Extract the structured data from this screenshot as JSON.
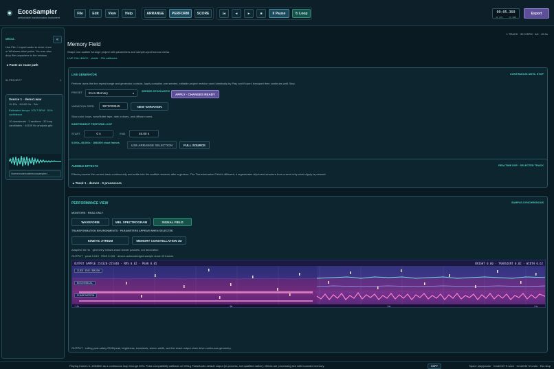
{
  "app": {
    "title": "EccoSampler",
    "subtitle": "performable transformation instrument"
  },
  "menu": [
    "File",
    "Edit",
    "View",
    "Help"
  ],
  "modes": [
    "ARRANGE",
    "PERFORM",
    "SCORE"
  ],
  "transport": {
    "start": "|◂",
    "back": "◂",
    "play": "▸",
    "stop": "■",
    "pause": "II Pause",
    "loop": "↻ Loop"
  },
  "time": {
    "main": "00:05.360",
    "left": "44 kHz",
    "right": "32 BAR"
  },
  "export_label": "Export",
  "sidebar": {
    "section": "MEDIA",
    "collapse": "«",
    "help_text": [
      "Use File > Import audio to enter Linux",
      "or Windows-drive paths. You can also",
      "drop files anywhere in the window."
    ],
    "paste_label": "▸ Paste an exact path",
    "in_project": "IN PROJECT",
    "in_project_count": "1",
    "source": {
      "name": "Source 1 · demo1.wav",
      "meta": "11.19s · 44100 Hz · 2ch",
      "tempo_lines": [
        "Estimated tempo: 103.7 BPM · 51%",
        "confidence"
      ],
      "stats_lines": [
        "10 downbeats · 2 sections · 32 loop",
        "candidates · 44100 Hz analysis grid"
      ],
      "path": "/home/code/code/eccosampler/..."
    }
  },
  "header": {
    "right": "1 TRACK · 92.0 BPM · 4/4 · 45.0s",
    "title": "Memory Field",
    "subtitle": "Shape one audible Arrange project with parameters and sample-synchronous views.",
    "callback": "LIVE CALLBACK · stable · 20k callbacks"
  },
  "live_generator": {
    "title": "LIVE GENERATOR",
    "tag": "CONTINUOUS UNTIL STOP",
    "desc": "Perform owns the live repeat range and generator controls. Apply compiles one seeded, editable project revision used identically by Play and Export; transport then continues until Stop.",
    "preset_label": "PRESET",
    "preset_value": "Ecco Memory",
    "seeded_tag": "SEEDED STOCHASTIC",
    "apply_label": "APPLY · CHANGES READY",
    "seed_label": "VARIATION SEED",
    "seed_value": "3972028945",
    "new_variation": "NEW VARIATION",
    "slow_text": "Slow color loops, wow/flutter tape, dark echoes, and diffuse rooms.",
    "loop_title": "INDEPENDENT PERFORM LOOP",
    "start_label": "START",
    "start_value": "0 s",
    "end_label": "END",
    "end_value": "45.00 s",
    "range_text": "0.000s–45.000s · 1984500 exact frames",
    "use_arrange": "USE ARRANGE SELECTION",
    "full_source": "FULL SOURCE"
  },
  "audible_effects": {
    "title": "AUDIBLE EFFECTS",
    "tag": "REALTIME DSP · SELECTED TRACK",
    "desc": "Effects process the current track continuously and settle into the audible renderer after a gesture. The Transformation Field is different: it regenerates clip/event structure from a seed only when Apply is pressed.",
    "track_label": "▸ Track 1 · demo1 · 0 processors"
  },
  "performance_view": {
    "title": "PERFORMANCE VIEW",
    "tag": "SAMPLE-SYNCHRONOUS",
    "monitors_label": "MONITORS · READ-ONLY",
    "monitors": [
      "WAVEFORM",
      "MEL SPECTROGRAM",
      "SIGNAL FIELD"
    ],
    "env_label": "TRANSFORMATION ENVIRONMENTS · PARAMETERS APPEAR WHEN SELECTED",
    "environments": [
      "KINETIC ATRIUM",
      "MEMORY CONSTELLATION 3D"
    ],
    "adaptive_text": "Adaptive 60 Hz · geometry follows exact render packets, not decoration",
    "output_text": "OUTPUT · peak 0.043 · RMS 0.026 · device-acknowledged sample clock 43 frames",
    "viz_header_left": "OUTPUT SAMPLE 254328-255448 · RMS 0.02 · PEAK 0.05",
    "viz_header_right": "BRIGHT 0.00 · TRANSIENT 0.02 · WIDTH 0.62",
    "viz_labels": [
      "CUES · ENV / BRUSH",
      "BIOCHEMICAL",
      "PHASE MOTION"
    ],
    "axis_ticks": [
      "−12s",
      "−8s",
      "+4s",
      "+4s"
    ],
    "footer_text": "OUTPUT · rolling post-safety RMS/peak, brightness, transients, stereo width, and the exact output clock drive continuous geometry."
  },
  "status": {
    "text": "Playing frames 0–1984500 as a continuous loop through WSL Pulse compatibility callback on WSLg PulseAudio default output (in-process, not qualified native); effects are processing live with bounded memory.",
    "copy": "COPY",
    "shortcuts": "Space play/pause · Cmd/Ctrl+S save · Cmd/Ctrl+Z undo · Esc stop"
  },
  "colors": {
    "accent": "#4fd1c5",
    "apply": "#5e4f99",
    "background": "#0a1a22"
  }
}
